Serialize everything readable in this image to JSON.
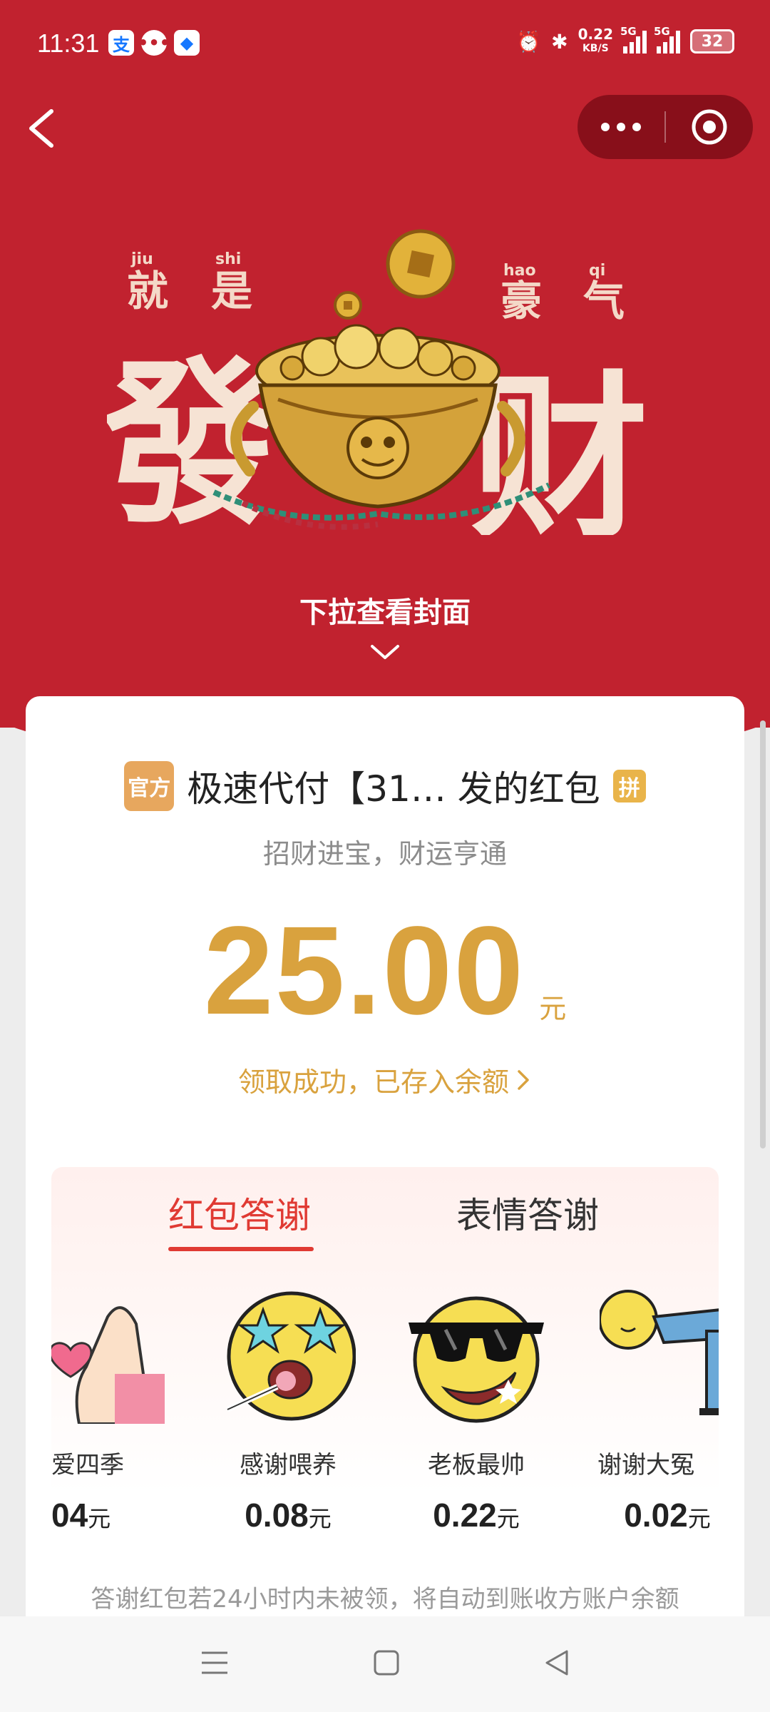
{
  "status_bar": {
    "time": "11:31",
    "net_speed_value": "0.22",
    "net_speed_unit": "KB/S",
    "signal_1_tag": "5G",
    "signal_2_tag": "5G",
    "battery": "32",
    "app_icons": [
      "alipay-icon",
      "message-icon",
      "bank-app-icon"
    ]
  },
  "cover": {
    "pinyin": [
      "jiu",
      "shi",
      "hao",
      "qi"
    ],
    "small_chars": [
      "就",
      "是",
      "豪",
      "气"
    ],
    "big_chars": [
      "發",
      "财"
    ],
    "pull_hint": "下拉查看封面"
  },
  "packet": {
    "official_badge": "官方",
    "sender_name": "极速代付【31… 发的红包",
    "group_badge": "拼",
    "blessing": "招财进宝，财运亨通",
    "amount": "25.00",
    "unit": "元",
    "success_text": "领取成功，已存入余额"
  },
  "thanks": {
    "tabs": [
      {
        "label": "红包答谢",
        "active": true
      },
      {
        "label": "表情答谢",
        "active": false
      }
    ],
    "stickers": [
      {
        "name": "爱四季",
        "price": "04",
        "unit": "元",
        "icon": "heart-hand-sticker"
      },
      {
        "name": "感谢喂养",
        "price": "0.08",
        "unit": "元",
        "icon": "star-eyes-lollipop-sticker"
      },
      {
        "name": "老板最帅",
        "price": "0.22",
        "unit": "元",
        "icon": "sunglasses-sticker"
      },
      {
        "name": "谢谢大冤",
        "price": "0.02",
        "unit": "元",
        "icon": "bowing-sticker"
      }
    ],
    "note": "答谢红包若24小时内未被领，将自动到账收方账户余额"
  },
  "colors": {
    "header_red": "#c1222f",
    "gold": "#d9a23e",
    "tab_active": "#e03a33"
  }
}
